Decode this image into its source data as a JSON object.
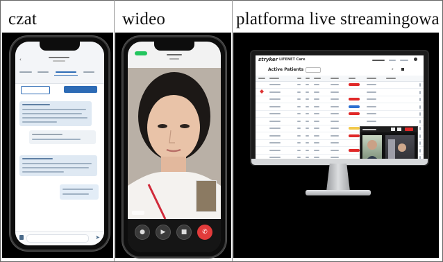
{
  "captions": {
    "chat": "czat",
    "video": "wideo",
    "live": "platforma live streamingowa"
  },
  "chat_phone": {
    "tabs": [
      "",
      "",
      "",
      ""
    ],
    "icons": [
      "back-icon",
      "attach-icon",
      "send-icon"
    ]
  },
  "video_phone": {
    "controls": [
      "mute-icon",
      "camera-icon",
      "speaker-icon",
      "end-call-icon"
    ],
    "control_glyphs": [
      "●",
      "▶",
      "■",
      "✆"
    ]
  },
  "live_platform": {
    "brand": "stryker",
    "product": "LIFENET Care",
    "list_title": "Active Patients",
    "status_colors": {
      "critical": "#e02828",
      "info": "#2c6fd1",
      "warning": "#f2c94c"
    },
    "video_popup_bg": "#111111"
  },
  "colors": {
    "panel_bg": "#000000",
    "chat_bubble": "#dfe9f3",
    "accent_blue": "#2d6bb5",
    "end_call": "#e23b3b"
  }
}
